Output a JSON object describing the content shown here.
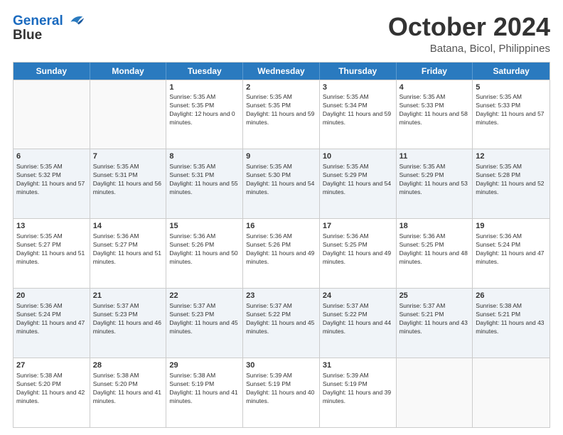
{
  "header": {
    "logo_line1": "General",
    "logo_line2": "Blue",
    "title": "October 2024",
    "subtitle": "Batana, Bicol, Philippines"
  },
  "calendar": {
    "days": [
      "Sunday",
      "Monday",
      "Tuesday",
      "Wednesday",
      "Thursday",
      "Friday",
      "Saturday"
    ],
    "weeks": [
      [
        {
          "day": "",
          "empty": true
        },
        {
          "day": "",
          "empty": true
        },
        {
          "day": "1",
          "sunrise": "5:35 AM",
          "sunset": "5:35 PM",
          "daylight": "12 hours and 0 minutes."
        },
        {
          "day": "2",
          "sunrise": "5:35 AM",
          "sunset": "5:35 PM",
          "daylight": "11 hours and 59 minutes."
        },
        {
          "day": "3",
          "sunrise": "5:35 AM",
          "sunset": "5:34 PM",
          "daylight": "11 hours and 59 minutes."
        },
        {
          "day": "4",
          "sunrise": "5:35 AM",
          "sunset": "5:33 PM",
          "daylight": "11 hours and 58 minutes."
        },
        {
          "day": "5",
          "sunrise": "5:35 AM",
          "sunset": "5:33 PM",
          "daylight": "11 hours and 57 minutes."
        }
      ],
      [
        {
          "day": "6",
          "sunrise": "5:35 AM",
          "sunset": "5:32 PM",
          "daylight": "11 hours and 57 minutes."
        },
        {
          "day": "7",
          "sunrise": "5:35 AM",
          "sunset": "5:31 PM",
          "daylight": "11 hours and 56 minutes."
        },
        {
          "day": "8",
          "sunrise": "5:35 AM",
          "sunset": "5:31 PM",
          "daylight": "11 hours and 55 minutes."
        },
        {
          "day": "9",
          "sunrise": "5:35 AM",
          "sunset": "5:30 PM",
          "daylight": "11 hours and 54 minutes."
        },
        {
          "day": "10",
          "sunrise": "5:35 AM",
          "sunset": "5:29 PM",
          "daylight": "11 hours and 54 minutes."
        },
        {
          "day": "11",
          "sunrise": "5:35 AM",
          "sunset": "5:29 PM",
          "daylight": "11 hours and 53 minutes."
        },
        {
          "day": "12",
          "sunrise": "5:35 AM",
          "sunset": "5:28 PM",
          "daylight": "11 hours and 52 minutes."
        }
      ],
      [
        {
          "day": "13",
          "sunrise": "5:35 AM",
          "sunset": "5:27 PM",
          "daylight": "11 hours and 51 minutes."
        },
        {
          "day": "14",
          "sunrise": "5:36 AM",
          "sunset": "5:27 PM",
          "daylight": "11 hours and 51 minutes."
        },
        {
          "day": "15",
          "sunrise": "5:36 AM",
          "sunset": "5:26 PM",
          "daylight": "11 hours and 50 minutes."
        },
        {
          "day": "16",
          "sunrise": "5:36 AM",
          "sunset": "5:26 PM",
          "daylight": "11 hours and 49 minutes."
        },
        {
          "day": "17",
          "sunrise": "5:36 AM",
          "sunset": "5:25 PM",
          "daylight": "11 hours and 49 minutes."
        },
        {
          "day": "18",
          "sunrise": "5:36 AM",
          "sunset": "5:25 PM",
          "daylight": "11 hours and 48 minutes."
        },
        {
          "day": "19",
          "sunrise": "5:36 AM",
          "sunset": "5:24 PM",
          "daylight": "11 hours and 47 minutes."
        }
      ],
      [
        {
          "day": "20",
          "sunrise": "5:36 AM",
          "sunset": "5:24 PM",
          "daylight": "11 hours and 47 minutes."
        },
        {
          "day": "21",
          "sunrise": "5:37 AM",
          "sunset": "5:23 PM",
          "daylight": "11 hours and 46 minutes."
        },
        {
          "day": "22",
          "sunrise": "5:37 AM",
          "sunset": "5:23 PM",
          "daylight": "11 hours and 45 minutes."
        },
        {
          "day": "23",
          "sunrise": "5:37 AM",
          "sunset": "5:22 PM",
          "daylight": "11 hours and 45 minutes."
        },
        {
          "day": "24",
          "sunrise": "5:37 AM",
          "sunset": "5:22 PM",
          "daylight": "11 hours and 44 minutes."
        },
        {
          "day": "25",
          "sunrise": "5:37 AM",
          "sunset": "5:21 PM",
          "daylight": "11 hours and 43 minutes."
        },
        {
          "day": "26",
          "sunrise": "5:38 AM",
          "sunset": "5:21 PM",
          "daylight": "11 hours and 43 minutes."
        }
      ],
      [
        {
          "day": "27",
          "sunrise": "5:38 AM",
          "sunset": "5:20 PM",
          "daylight": "11 hours and 42 minutes."
        },
        {
          "day": "28",
          "sunrise": "5:38 AM",
          "sunset": "5:20 PM",
          "daylight": "11 hours and 41 minutes."
        },
        {
          "day": "29",
          "sunrise": "5:38 AM",
          "sunset": "5:19 PM",
          "daylight": "11 hours and 41 minutes."
        },
        {
          "day": "30",
          "sunrise": "5:39 AM",
          "sunset": "5:19 PM",
          "daylight": "11 hours and 40 minutes."
        },
        {
          "day": "31",
          "sunrise": "5:39 AM",
          "sunset": "5:19 PM",
          "daylight": "11 hours and 39 minutes."
        },
        {
          "day": "",
          "empty": true
        },
        {
          "day": "",
          "empty": true
        }
      ]
    ]
  }
}
